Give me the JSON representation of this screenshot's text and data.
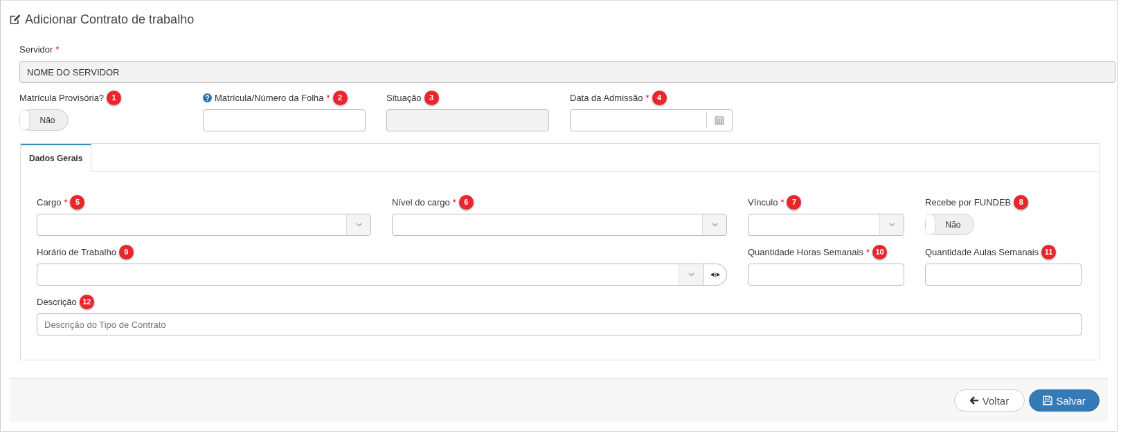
{
  "title": "Adicionar Contrato de trabalho",
  "servidor": {
    "kind": "text",
    "label": "Servidor",
    "required_mark": "*",
    "value": "NOME DO SERVIDOR",
    "disabled": true
  },
  "top_fields": [
    {
      "kind": "toggle",
      "label": "Matrícula Provisória?",
      "badge": "1",
      "toggle_label": "Não",
      "on": false
    },
    {
      "kind": "text",
      "label": "Matrícula/Número da Folha",
      "help": true,
      "required_mark": "*",
      "badge": "2"
    },
    {
      "kind": "text",
      "label": "Situação",
      "badge": "3",
      "disabled": true
    },
    {
      "kind": "date",
      "label": "Data da Admissão",
      "required_mark": "*",
      "badge": "4"
    }
  ],
  "tabs": [
    {
      "label": "Dados Gerais",
      "selected": true
    }
  ],
  "tab_fields": [
    {
      "kind": "select",
      "label": "Cargo",
      "required_mark": "*",
      "badge": "5"
    },
    {
      "kind": "select",
      "label": "Nível do cargo",
      "required_mark": "*",
      "badge": "6"
    },
    {
      "kind": "select",
      "label": "Vínculo",
      "required_mark": "*",
      "badge": "7"
    },
    {
      "kind": "toggle",
      "label": "Recebe por FUNDEB",
      "badge": "8",
      "toggle_label": "Não",
      "on": false
    },
    {
      "kind": "select_view",
      "label": "Horário de Trabalho",
      "badge": "9"
    },
    {
      "kind": "text",
      "label": "Quantidade Horas Semanais",
      "required_mark": "*",
      "badge": "10"
    },
    {
      "kind": "text",
      "label": "Quantidade Aulas Semanais",
      "badge": "11"
    },
    {
      "kind": "wide_text",
      "label": "Descrição",
      "badge": "12",
      "placeholder": "Descrição do Tipo de Contrato"
    }
  ],
  "buttons": [
    {
      "kind": "back",
      "label": "Voltar"
    },
    {
      "kind": "primary",
      "label": "Salvar"
    }
  ]
}
